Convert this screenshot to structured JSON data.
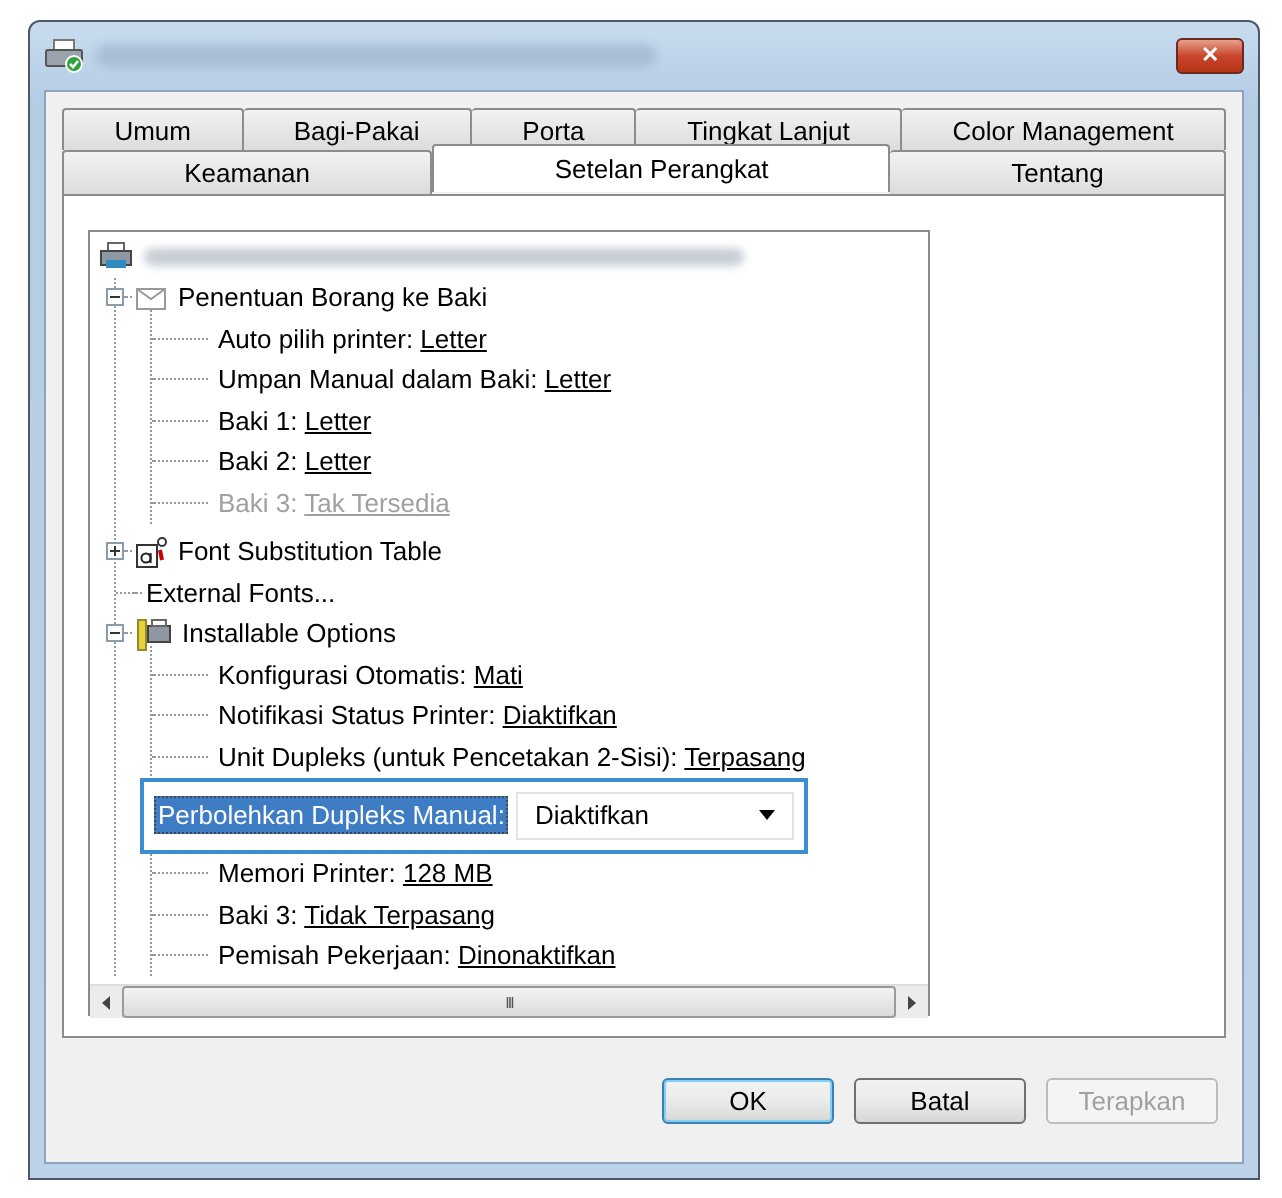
{
  "window": {
    "close_label": "✕"
  },
  "tabs": [
    [
      {
        "label": "Umum",
        "selected": false
      },
      {
        "label": "Bagi-Pakai",
        "selected": false
      },
      {
        "label": "Porta",
        "selected": false
      },
      {
        "label": "Tingkat Lanjut",
        "selected": false
      },
      {
        "label": "Color Management",
        "selected": false
      }
    ],
    [
      {
        "label": "Keamanan",
        "selected": false
      },
      {
        "label": "Setelan Perangkat",
        "selected": true
      },
      {
        "label": "Tentang",
        "selected": false
      }
    ]
  ],
  "tree": {
    "groups": [
      {
        "kind": "form",
        "label": "Penentuan Borang ke Baki",
        "expanded": true,
        "children": [
          {
            "kind": "setting",
            "label": "Auto pilih printer:",
            "value": "Letter",
            "disabled": false
          },
          {
            "kind": "setting",
            "label": "Umpan Manual dalam Baki:",
            "value": "Letter",
            "disabled": false
          },
          {
            "kind": "setting",
            "label": "Baki 1:",
            "value": "Letter",
            "disabled": false
          },
          {
            "kind": "setting",
            "label": "Baki 2:",
            "value": "Letter",
            "disabled": false
          },
          {
            "kind": "setting",
            "label": "Baki 3:",
            "value": "Tak Tersedia",
            "disabled": true
          }
        ]
      },
      {
        "kind": "font",
        "label": "Font Substitution Table",
        "expanded": false
      },
      {
        "kind": "plain",
        "label": "External Fonts..."
      },
      {
        "kind": "options",
        "label": "Installable Options",
        "expanded": true,
        "children": [
          {
            "kind": "setting",
            "label": "Konfigurasi Otomatis:",
            "value": "Mati",
            "disabled": false
          },
          {
            "kind": "setting",
            "label": "Notifikasi Status Printer:",
            "value": "Diaktifkan",
            "disabled": false
          },
          {
            "kind": "setting",
            "label": "Unit Dupleks (untuk Pencetakan 2-Sisi):",
            "value": "Terpasang",
            "disabled": false
          },
          {
            "kind": "editor",
            "label": "Perbolehkan Dupleks Manual:",
            "value": "Diaktifkan",
            "selected": true
          },
          {
            "kind": "setting",
            "label": "Memori Printer:",
            "value": "128 MB",
            "disabled": false
          },
          {
            "kind": "setting",
            "label": "Baki 3:",
            "value": "Tidak Terpasang",
            "disabled": false
          },
          {
            "kind": "setting",
            "label": "Pemisah Pekerjaan:",
            "value": "Dinonaktifkan",
            "disabled": false
          }
        ]
      }
    ]
  },
  "scrollbar": {
    "grip": "III"
  },
  "buttons": [
    {
      "label": "OK",
      "default": true,
      "disabled": false
    },
    {
      "label": "Batal",
      "default": false,
      "disabled": false
    },
    {
      "label": "Terapkan",
      "default": false,
      "disabled": true
    }
  ]
}
